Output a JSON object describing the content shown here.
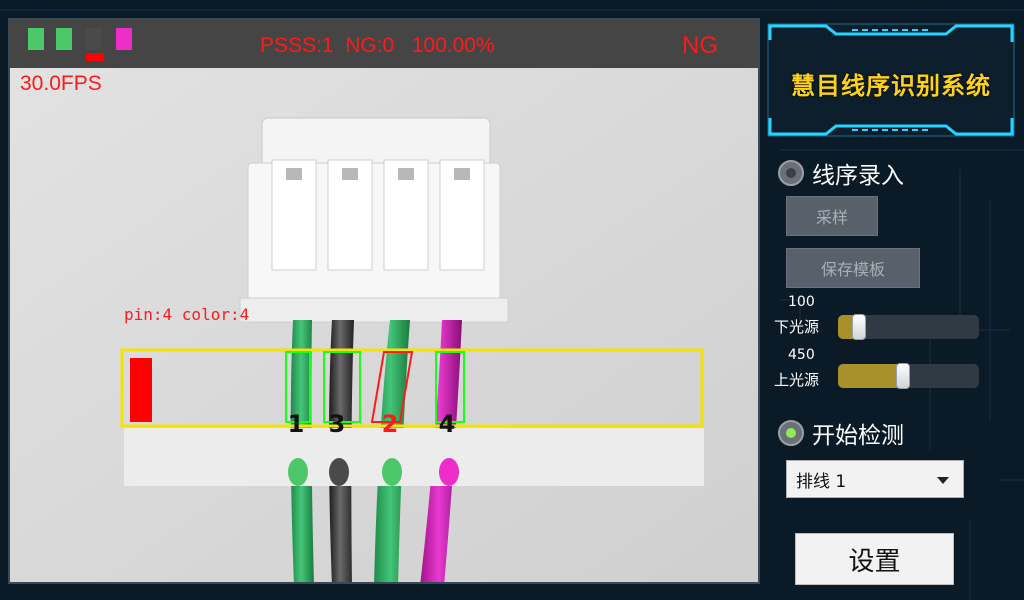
{
  "header": {
    "stats_text": "PSSS:1  NG:0   100.00%",
    "result": "NG",
    "fps": "30.0FPS",
    "swatches": [
      "#4cc86a",
      "#4cc86a",
      "#4a4a4a",
      "#ee2cc8"
    ]
  },
  "detection": {
    "pin_label": "pin:4  color:4",
    "order_numbers": [
      {
        "text": "1",
        "color": "#111111",
        "dot": "#4cc86a"
      },
      {
        "text": "3",
        "color": "#111111",
        "dot": "#4a4a4a"
      },
      {
        "text": "2",
        "color": "#ff1a1a",
        "dot": "#4cc86a"
      },
      {
        "text": "4",
        "color": "#111111",
        "dot": "#ee2cc8"
      }
    ]
  },
  "panel": {
    "title": "慧目线序识别系统",
    "mode_record": "线序录入",
    "sample_button": "采样",
    "save_template_button": "保存模板",
    "lower_light": {
      "label": "下光源",
      "value": "100"
    },
    "upper_light": {
      "label": "上光源",
      "value": "450"
    },
    "mode_detect": "开始检测",
    "cable_select": "排线 1",
    "settings_button": "设置"
  },
  "colors": {
    "alarm_red": "#ff1a1a",
    "title_gold": "#ffd21a",
    "slider_fill": "#a8912a"
  }
}
